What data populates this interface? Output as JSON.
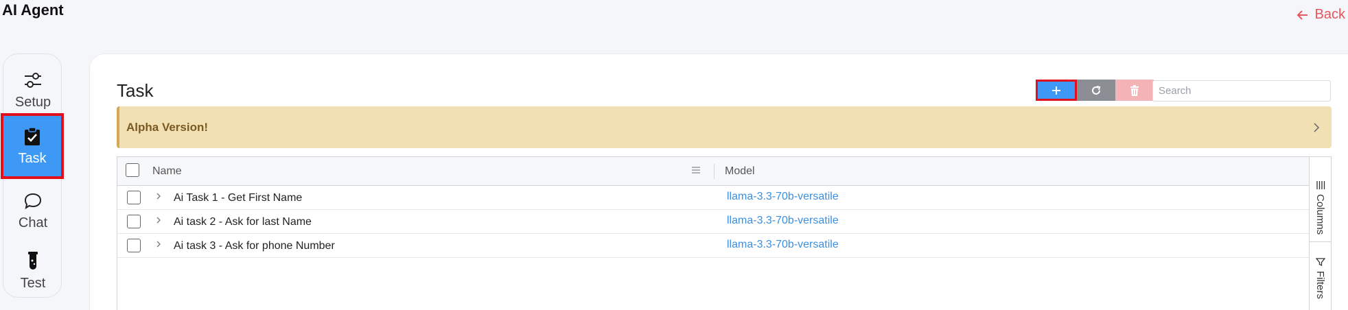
{
  "app": {
    "title": "AI Agent",
    "back_label": "Back"
  },
  "sidebar": {
    "items": [
      {
        "label": "Setup",
        "icon": "sliders-icon"
      },
      {
        "label": "Task",
        "icon": "clipboard-check-icon",
        "active": true
      },
      {
        "label": "Chat",
        "icon": "chat-bubble-icon"
      },
      {
        "label": "Test",
        "icon": "test-tube-icon"
      }
    ]
  },
  "main": {
    "title": "Task",
    "search": {
      "placeholder": "Search",
      "value": ""
    },
    "toolbar": {
      "add": "+",
      "icons": [
        "plus-icon",
        "refresh-icon",
        "trash-icon"
      ]
    },
    "alert": {
      "text": "Alpha Version!"
    },
    "grid": {
      "columns": [
        "Name",
        "Model"
      ],
      "rows": [
        {
          "name": "Ai Task 1 - Get First Name",
          "model": "llama-3.3-70b-versatile"
        },
        {
          "name": "Ai task 2 - Ask for last Name",
          "model": "llama-3.3-70b-versatile"
        },
        {
          "name": "Ai task 3 - Ask for phone Number",
          "model": "llama-3.3-70b-versatile"
        }
      ],
      "side_panel": {
        "columns_label": "Columns",
        "filters_label": "Filters"
      }
    }
  },
  "colors": {
    "accent": "#3d99f5",
    "highlight_border": "#e3101b",
    "alert_bg": "#f1e0b4",
    "link": "#3b8fe0",
    "back": "#e8555b"
  }
}
